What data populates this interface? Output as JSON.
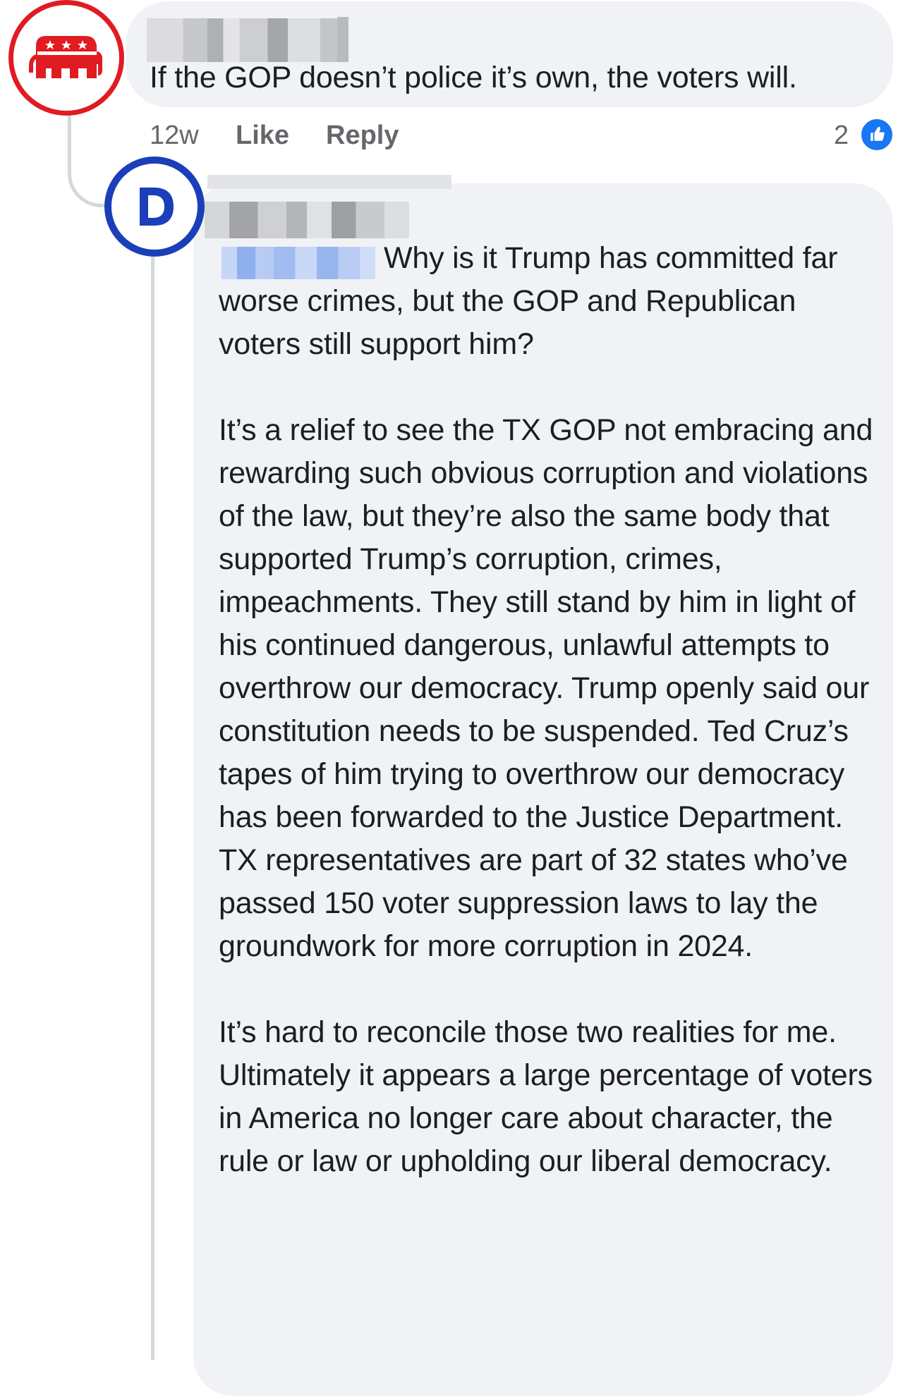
{
  "comment_1": {
    "author_name": "",
    "avatar_icon": "gop-elephant-icon",
    "text": "If the GOP doesn’t police it’s own, the voters will.",
    "meta": {
      "time": "12w",
      "like_label": "Like",
      "reply_label": "Reply",
      "reaction_count": "2",
      "reaction_icon": "thumbs-up-icon"
    }
  },
  "comment_2": {
    "author_name": "",
    "avatar_icon": "democratic-d-icon",
    "mention": "",
    "paragraphs": [
      "Why is it Trump has committed far worse crimes, but the GOP and Republican voters still support him?",
      "It’s a relief to see the TX GOP not embracing and rewarding such obvious corruption and violations of the law, but they’re  also the same body that supported Trump’s corruption, crimes, impeachments. They still stand by him in light of his continued dangerous, unlawful attempts to overthrow our democracy. Trump openly said our constitution needs to be suspended. Ted Cruz’s tapes of him trying to overthrow our democracy has been forwarded to the Justice Department. TX representatives are part of 32 states who’ve passed 150 voter suppression laws to lay the groundwork for more corruption  in 2024.",
      "It’s hard to reconcile those two realities for me. Ultimately it appears a large percentage of voters in America no longer care about character, the rule or law or upholding our liberal democracy."
    ]
  },
  "colors": {
    "gop_red": "#e11b22",
    "dem_blue": "#1a3fb8",
    "like_blue": "#1877f2",
    "bubble_bg": "#f0f2f5",
    "meta_gray": "#65676b"
  }
}
